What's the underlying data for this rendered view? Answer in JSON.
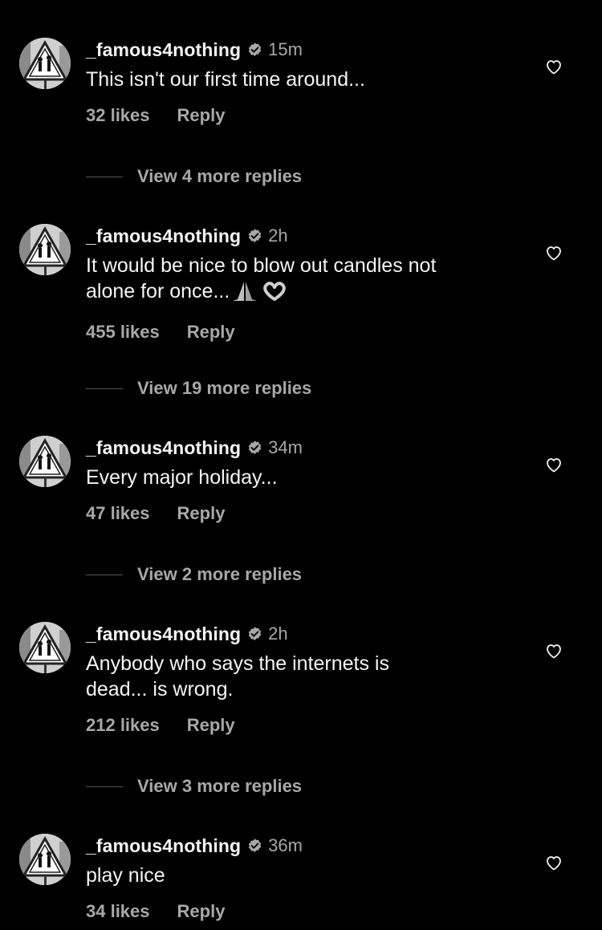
{
  "comments": [
    {
      "username": "_famous4nothing",
      "time": "15m",
      "text": "This isn't our first time around...",
      "likes": "32 likes",
      "reply": "Reply",
      "view_more": "View 4 more replies"
    },
    {
      "username": "_famous4nothing",
      "time": "2h",
      "text": "It would be nice to blow out candles not\nalone for once...",
      "text_emojis": [
        "folded-hands-emoji",
        "heart-hands-emoji"
      ],
      "likes": "455 likes",
      "reply": "Reply",
      "view_more": "View 19 more replies"
    },
    {
      "username": "_famous4nothing",
      "time": "34m",
      "text": "Every major holiday...",
      "likes": "47 likes",
      "reply": "Reply",
      "view_more": "View 2 more replies"
    },
    {
      "username": "_famous4nothing",
      "time": "2h",
      "text": "Anybody who says the internets is\ndead... is wrong.",
      "likes": "212 likes",
      "reply": "Reply",
      "view_more": "View 3 more replies"
    },
    {
      "username": "_famous4nothing",
      "time": "36m",
      "text": "play nice",
      "likes": "34 likes",
      "reply": "Reply"
    }
  ],
  "icons": {
    "avatar": "warning-sign-avatar",
    "verified": "verified-badge-icon",
    "like": "heart-outline-icon"
  },
  "colors": {
    "background": "#000000",
    "primary_text": "#f5f5f5",
    "secondary_text": "#a8a8a8"
  }
}
